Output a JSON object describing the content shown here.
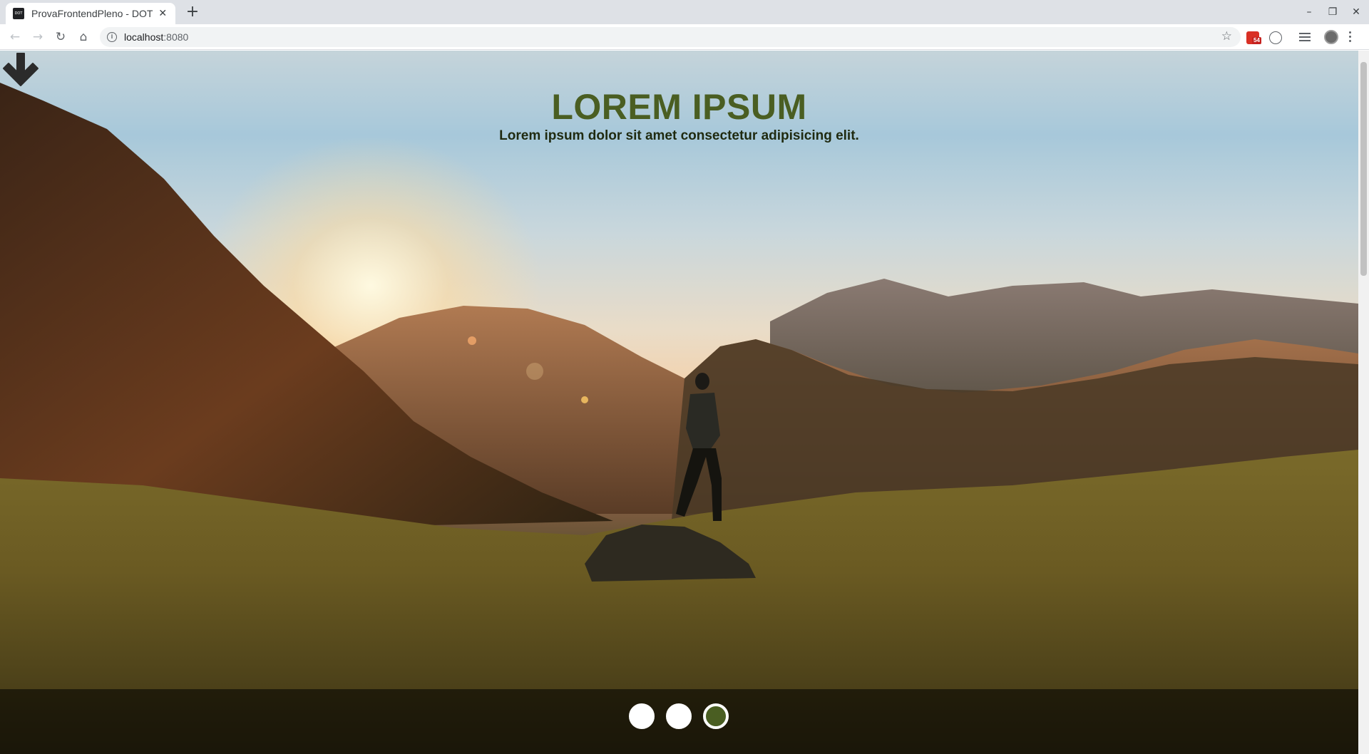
{
  "browser": {
    "tab_title": "ProvaFrontendPleno - DOT",
    "favicon_text": "DOT",
    "new_tab": "+",
    "tab_close": "✕",
    "url_host": "localhost",
    "url_port": ":8080",
    "gmail_badge": "54",
    "window_controls": {
      "minimize": "–",
      "restore": "❐",
      "close": "✕"
    },
    "nav": {
      "back": "←",
      "forward": "→",
      "reload": "↻",
      "home": "⌂"
    },
    "icons": [
      "back-arrow-icon",
      "forward-arrow-icon",
      "reload-icon",
      "home-icon",
      "info-icon",
      "star-icon",
      "gmail-icon",
      "extension-icon",
      "media-icon",
      "profile-icon",
      "menu-icon"
    ]
  },
  "hero": {
    "title": "LOREM IPSUM",
    "subtitle": "Lorem ipsum dolor sit amet consectetur adipisicing elit.",
    "arrow_icon": "arrow-down-icon",
    "slides": [
      {
        "active": false
      },
      {
        "active": false
      },
      {
        "active": true
      }
    ]
  },
  "colors": {
    "title": "#4a5e22",
    "subtitle": "#1f2a10",
    "active_dot": "#4a5e22",
    "dot": "#ffffff"
  }
}
